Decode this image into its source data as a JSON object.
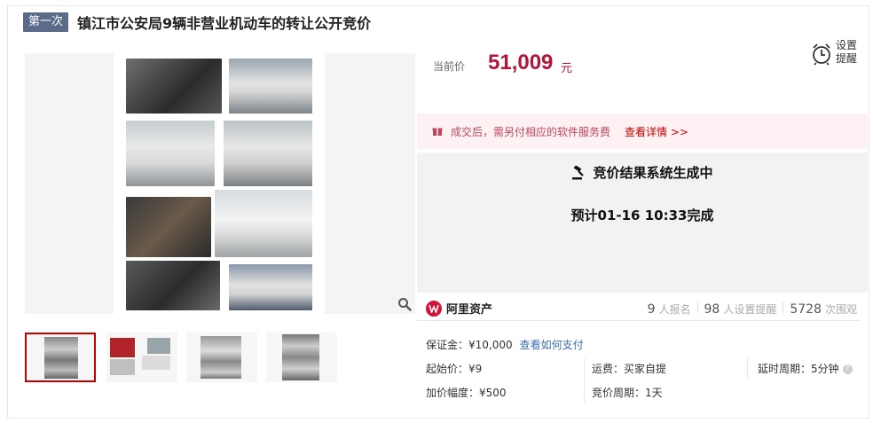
{
  "title": {
    "round_tag": "第一次",
    "text": "镇江市公安局9辆非营业机动车的转让公开竞价"
  },
  "gallery": {
    "thumbnails": [
      "thumb-1",
      "thumb-2",
      "thumb-3",
      "thumb-4"
    ],
    "active_index": 0
  },
  "price": {
    "label": "当前价",
    "value": "51,009",
    "unit": "元"
  },
  "reminder": {
    "label_line1": "设置",
    "label_line2": "提醒"
  },
  "notice": {
    "text": "成交后，需另付相应的软件服务费",
    "link": "查看详情 >>"
  },
  "status": {
    "line1": "竞价结果系统生成中",
    "line2": "预计01-16 10:33完成"
  },
  "platform": {
    "name": "阿里资产",
    "signups_num": "9",
    "signups_label": "人报名",
    "reminders_num": "98",
    "reminders_label": "人设置提醒",
    "views_num": "5728",
    "views_label": "次围观"
  },
  "details": {
    "deposit": "保证金：¥10,000",
    "deposit_link": "查看如何支付",
    "start_price": "起始价：¥9",
    "shipping": "运费：买家自提",
    "delay": "延时周期：5分钟",
    "increment": "加价幅度：¥500",
    "cycle": "竞价周期：1天"
  },
  "colors": {
    "accent": "#b1173b",
    "tag_bg": "#5b6b8a",
    "notice_bg": "#fdf1f3",
    "link": "#3b6fb6"
  }
}
